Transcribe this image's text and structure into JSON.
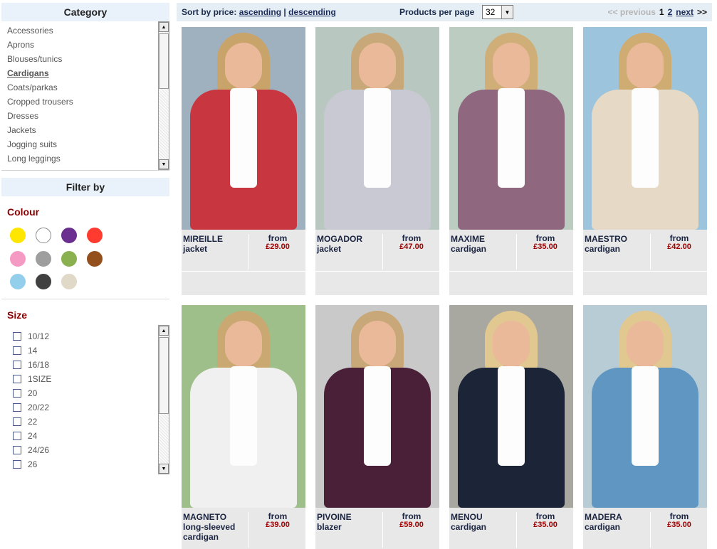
{
  "category": {
    "title": "Category",
    "items": [
      "Accessories",
      "Aprons",
      "Blouses/tunics",
      "Cardigans",
      "Coats/parkas",
      "Cropped trousers",
      "Dresses",
      "Jackets",
      "Jogging suits",
      "Long leggings"
    ],
    "active": "Cardigans"
  },
  "filter": {
    "title": "Filter by",
    "colour_label": "Colour",
    "colours": [
      "#ffe600",
      "#ffffff",
      "#6a2f8f",
      "#ff3b30",
      "#f59bc3",
      "#9e9e9e",
      "#8ab050",
      "#94501c",
      "#93cfeb",
      "#404040",
      "#e0d9c8"
    ],
    "size_label": "Size",
    "sizes": [
      "10/12",
      "14",
      "16/18",
      "1SIZE",
      "20",
      "20/22",
      "22",
      "24",
      "24/26",
      "26"
    ]
  },
  "topbar": {
    "sort_label": "Sort by price:",
    "ascending": "ascending",
    "separator": "|",
    "descending": "descending",
    "per_page_label": "Products per page",
    "per_page_value": "32",
    "prev": "<< previous",
    "page_current": "1",
    "page_2": "2",
    "next_link": "next",
    "next_arrows": ">>"
  },
  "products": [
    {
      "name_line1": "MIREILLE",
      "name_line2": "jacket",
      "name_line3": "",
      "from": "from",
      "price": "£29.00",
      "garment_color": "#c8363f",
      "hair_color": "#c9a46a",
      "bg_color": "#9fb0bf"
    },
    {
      "name_line1": "MOGADOR",
      "name_line2": "jacket",
      "name_line3": "",
      "from": "from",
      "price": "£47.00",
      "garment_color": "#c8c9d2",
      "hair_color": "#c8a878",
      "bg_color": "#b8c8c0"
    },
    {
      "name_line1": "MAXIME",
      "name_line2": "cardigan",
      "name_line3": "",
      "from": "from",
      "price": "£35.00",
      "garment_color": "#8f6880",
      "hair_color": "#d0ae78",
      "bg_color": "#bcccc0"
    },
    {
      "name_line1": "MAESTRO",
      "name_line2": "cardigan",
      "name_line3": "",
      "from": "from",
      "price": "£42.00",
      "garment_color": "#e6dac6",
      "hair_color": "#cfac72",
      "bg_color": "#9cc4dc"
    },
    {
      "name_line1": "MAGNETO",
      "name_line2": "long-sleeved",
      "name_line3": "cardigan",
      "from": "from",
      "price": "£39.00",
      "garment_color": "#f0f0f0",
      "hair_color": "#c9a872",
      "bg_color": "#9fbf8a"
    },
    {
      "name_line1": "PIVOINE",
      "name_line2": "blazer",
      "name_line3": "",
      "from": "from",
      "price": "£59.00",
      "garment_color": "#4a2038",
      "hair_color": "#c8a878",
      "bg_color": "#c9c9c9"
    },
    {
      "name_line1": "MENOU",
      "name_line2": "cardigan",
      "name_line3": "",
      "from": "from",
      "price": "£35.00",
      "garment_color": "#1c2438",
      "hair_color": "#e0c890",
      "bg_color": "#a8a8a0"
    },
    {
      "name_line1": "MADERA",
      "name_line2": "cardigan",
      "name_line3": "",
      "from": "from",
      "price": "£35.00",
      "garment_color": "#5f96c2",
      "hair_color": "#e0c890",
      "bg_color": "#b8ccd6"
    }
  ]
}
